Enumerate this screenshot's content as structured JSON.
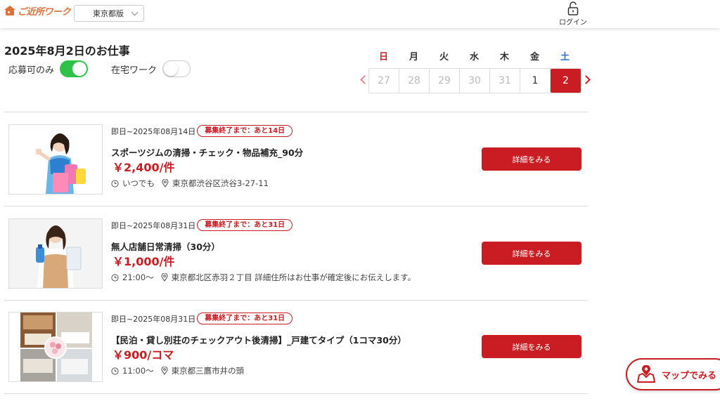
{
  "header": {
    "logo_text": "ご近所ワーク",
    "region": "東京都版",
    "login_label": "ログイン"
  },
  "page": {
    "title": "2025年8月2日のお仕事",
    "toggles": [
      {
        "label": "応募可のみ",
        "on": true
      },
      {
        "label": "在宅ワーク",
        "on": false
      }
    ]
  },
  "calendar": {
    "weekdays": [
      "日",
      "月",
      "火",
      "水",
      "木",
      "金",
      "土"
    ],
    "days": [
      "27",
      "28",
      "29",
      "30",
      "31",
      "1",
      "2"
    ],
    "selected": "2",
    "colors": {
      "sunday": "#d01c2a",
      "saturday": "#2a6fd0",
      "selected_bg": "#c91c23"
    }
  },
  "jobs": [
    {
      "period": "即日~2025年08月14日",
      "deadline": "募集終了まで：あと14日",
      "title": "スポーツジムの清掃・チェック・物品補充_90分",
      "pay": "￥2,400/件",
      "time": "いつでも",
      "location": "東京都渋谷区渋谷3-27-11",
      "button": "詳細をみる",
      "image": "cleaning-woman-with-supplies"
    },
    {
      "period": "即日~2025年08月31日",
      "deadline": "募集終了まで：あと31日",
      "title": "無人店舗日常清掃（30分）",
      "pay": "￥1,000/件",
      "time": "21:00～",
      "location": "東京都北区赤羽２丁目 詳細住所はお仕事が確定後にお伝えします。",
      "button": "詳細をみる",
      "image": "woman-in-apron-with-cloth"
    },
    {
      "period": "即日~2025年08月31日",
      "deadline": "募集終了まで：あと31日",
      "title": "【民泊・貸し別荘のチェックアウト後清掃】_戸建てタイプ（1コマ30分）",
      "pay": "￥900/コマ",
      "time": "11:00～",
      "location": "東京都三鷹市井の頭",
      "button": "詳細をみる",
      "image": "rental-house-rooms-collage"
    }
  ],
  "map_button": {
    "label": "マップでみる"
  },
  "colors": {
    "brand": "#c91c23",
    "logo": "#e0703a",
    "toggle_on": "#2ec24a"
  }
}
